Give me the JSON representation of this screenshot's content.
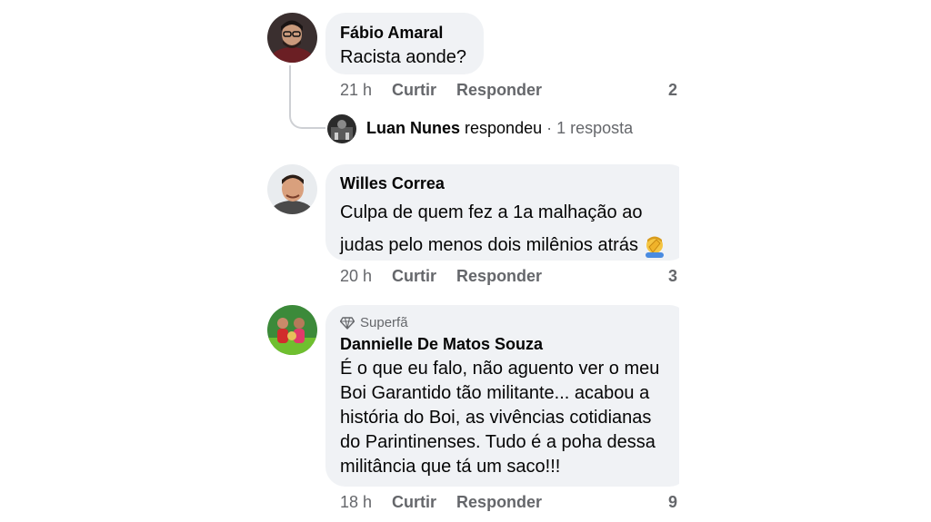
{
  "comments": [
    {
      "author": "Fábio Amaral",
      "text": "Racista aonde?",
      "time": "21 h",
      "like_label": "Curtir",
      "reply_label": "Responder",
      "reaction_count": "2",
      "reply_preview": {
        "author": "Luan Nunes",
        "verb": "respondeu",
        "count": "· 1 resposta"
      }
    },
    {
      "author": "Willes Correa",
      "text_line1": "Culpa de quem fez a 1a malhação ao",
      "text_line2": "judas pelo menos dois milênios atrás",
      "emoji": "facepalm-emoji",
      "time": "20 h",
      "like_label": "Curtir",
      "reply_label": "Responder",
      "reaction_count": "3"
    },
    {
      "badge": "Superfã",
      "badge_icon": "diamond-icon",
      "author": "Dannielle De Matos Souza",
      "lines": [
        "É o que eu falo, não aguento ver o meu",
        "Boi Garantido tão militante... acabou a",
        "história do Boi, as vivências cotidianas",
        "do Parintinenses. Tudo é a poha dessa",
        "militância que tá um saco!!!"
      ],
      "time": "18 h",
      "like_label": "Curtir",
      "reply_label": "Responder",
      "reaction_count": "9"
    }
  ],
  "colors": {
    "bubble": "#f0f2f5",
    "meta": "#65676b",
    "text": "#050505"
  }
}
